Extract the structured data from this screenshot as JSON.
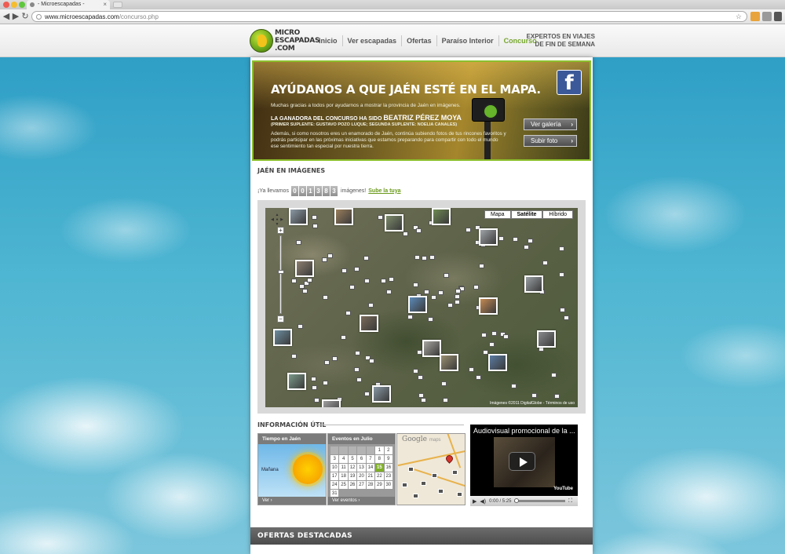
{
  "browser": {
    "tab_title": "- Microescapadas -",
    "tab_close": "×",
    "url_host": "www.microescapadas.com",
    "url_path": "/concurso.php",
    "back_glyph": "◀",
    "forward_glyph": "▶",
    "reload_glyph": "↻",
    "star_glyph": "☆"
  },
  "header": {
    "logo_line1": "MICRO",
    "logo_line2": "ESCAPADAS",
    "logo_line3": ".COM",
    "nav": [
      "Inicio",
      "Ver escapadas",
      "Ofertas",
      "Paraíso Interior",
      "Concurso"
    ],
    "active_nav": "Concurso",
    "tagline_line1": "EXPERTOS EN VIAJES",
    "tagline_line2": "DE FIN DE SEMANA"
  },
  "banner": {
    "title": "AYÚDANOS A QUE JAÉN ESTÉ EN EL MAPA.",
    "thanks": "Muchas gracias a todos por ayudarnos a mostrar la provincia de Jaén en imágenes.",
    "winner_prefix": "LA GANADORA DEL CONCURSO HA SIDO",
    "winner_name": "BEATRIZ PÉREZ MOYA",
    "runners_up": "(PRIMER SUPLENTE: GUSTAVO POZO LUQUE; SEGUNDA SUPLENTE: NOELIA CANALES)",
    "paragraph": "Además, si como nosotros eres un enamorado de Jaén, continúa subiendo fotos de tus rincones favoritos y podrás participar en las próximas iniciativas que estamos preparando para compartir con todo el mundo ese sentimiento tan especial por nuestra tierra.",
    "facebook_glyph": "f",
    "btn_gallery": "Ver galería",
    "btn_upload": "Subir foto",
    "btn_chevron": "›"
  },
  "gallery": {
    "title": "JAÉN EN IMÁGENES",
    "counter_prefix": "¡Ya llevamos",
    "counter_digits": [
      "0",
      "0",
      "1",
      "3",
      "8",
      "3"
    ],
    "counter_suffix": "imágenes!",
    "upload_link": "Sube la tuya"
  },
  "map": {
    "types": [
      "Mapa",
      "Satélite",
      "Híbrido"
    ],
    "active_type": "Satélite",
    "zoom_in": "+",
    "zoom_out": "−",
    "zoom_level": 0.45,
    "copyright": "Imágenes ©2011 DigitalGlobe - Términos de uso"
  },
  "info": {
    "title": "INFORMACIÓN ÚTIL",
    "weather": {
      "head": "Tiempo en Jaén",
      "day": "Mañana",
      "footer": "Ver ›"
    },
    "events": {
      "head": "Eventos en Julio",
      "footer": "Ver eventos ›",
      "days": [
        "",
        "",
        "",
        "",
        "",
        "1",
        "2",
        "3",
        "4",
        "5",
        "6",
        "7",
        "8",
        "9",
        "10",
        "11",
        "12",
        "13",
        "14",
        "15",
        "16",
        "17",
        "18",
        "19",
        "20",
        "21",
        "22",
        "23",
        "24",
        "25",
        "26",
        "27",
        "28",
        "29",
        "30",
        "31"
      ],
      "today": "15"
    },
    "gmaps": {
      "logo": "Google",
      "logo_suffix": "maps"
    },
    "video": {
      "title": "Audiovisual promocional de la ...",
      "time": "0:00 / 5:25",
      "youtube": "YouTube",
      "play_glyph": "▶",
      "volume_glyph": "◀)",
      "fullscreen_glyph": "⛶"
    }
  },
  "ofertas": {
    "title": "OFERTAS DESTACADAS"
  },
  "colors": {
    "accent_green": "#76a72d",
    "facebook_blue": "#3b5998",
    "bar_grey": "#7b7b7b"
  }
}
